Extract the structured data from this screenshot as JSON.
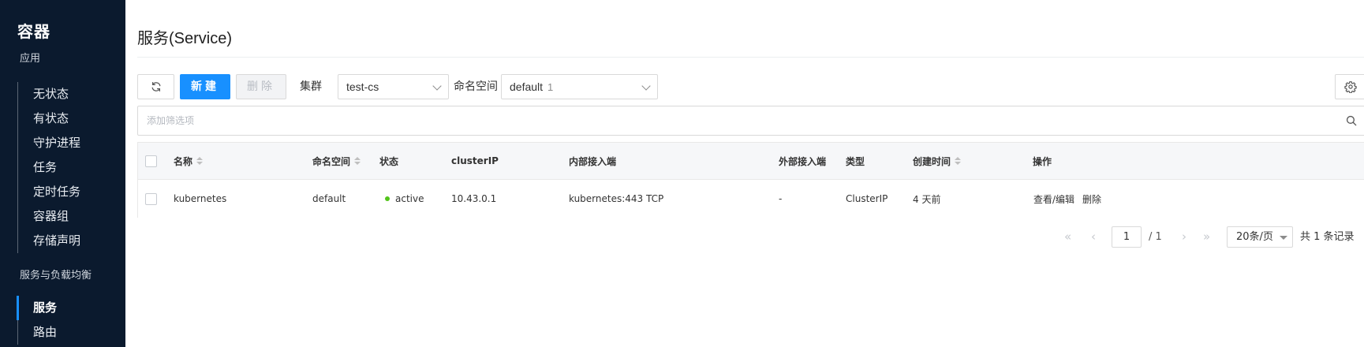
{
  "sidebar": {
    "title": "容器",
    "section_apps": "应用",
    "app_items": [
      {
        "label": "无状态"
      },
      {
        "label": "有状态"
      },
      {
        "label": "守护进程"
      },
      {
        "label": "任务"
      },
      {
        "label": "定时任务"
      },
      {
        "label": "容器组"
      },
      {
        "label": "存储声明"
      }
    ],
    "section_lb": "服务与负载均衡",
    "lb_items": [
      {
        "label": "服务",
        "active": true
      },
      {
        "label": "路由"
      }
    ],
    "active_color": "#1890ff"
  },
  "page": {
    "title": "服务(Service)"
  },
  "toolbar": {
    "refresh_icon": "refresh-icon",
    "new_label": "新建",
    "delete_label": "删除",
    "cluster_label": "集群",
    "cluster_value": "test-cs",
    "namespace_label": "命名空间",
    "namespace_value": "default",
    "namespace_count": "1",
    "settings_icon": "gear-icon"
  },
  "filter": {
    "placeholder": "添加筛选项",
    "icon": "search-icon"
  },
  "table": {
    "columns": {
      "name": "名称",
      "namespace": "命名空间",
      "status": "状态",
      "cluster_ip": "clusterIP",
      "internal_endpoint": "内部接入端",
      "external_endpoint": "外部接入端",
      "type": "类型",
      "created": "创建时间",
      "actions": "操作"
    },
    "rows": [
      {
        "name": "kubernetes",
        "namespace": "default",
        "status": "active",
        "status_color": "#52c41a",
        "cluster_ip": "10.43.0.1",
        "internal_endpoint": "kubernetes:443 TCP",
        "external_endpoint": "-",
        "type": "ClusterIP",
        "created": "4 天前",
        "action_edit": "查看/编辑",
        "action_delete": "删除"
      }
    ]
  },
  "pagination": {
    "current_page": "1",
    "total_pages": "/ 1",
    "page_size": "20条/页",
    "total_records": "共 1 条记录"
  },
  "colors": {
    "primary": "#1890ff",
    "sidebar_bg": "#0b1a2e"
  }
}
